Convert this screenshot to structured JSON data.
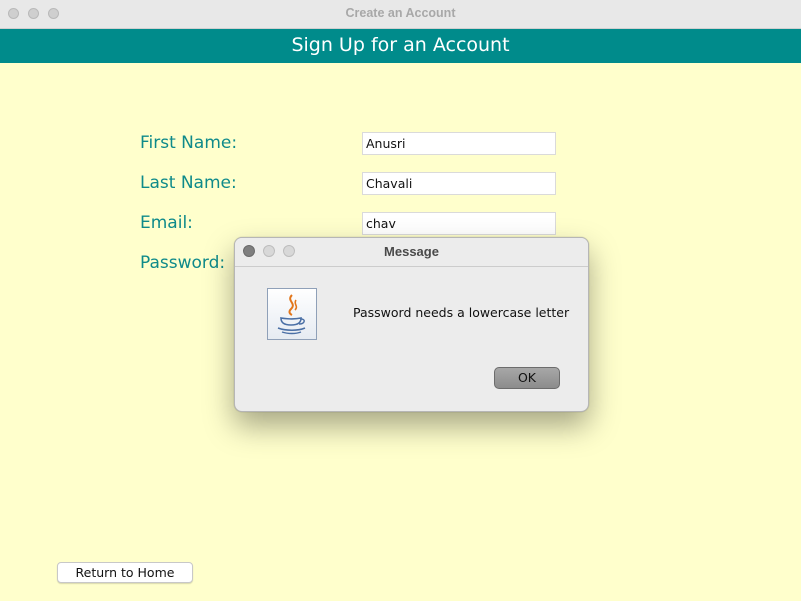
{
  "window": {
    "title": "Create an Account",
    "header": "Sign Up for an Account",
    "background": "#ffffcc",
    "accent": "#008b8b"
  },
  "form": {
    "first_name_label": "First Name:",
    "first_name_value": "Anusri",
    "last_name_label": "Last Name:",
    "last_name_value": "Chavali",
    "email_label": "Email:",
    "email_value": "chav",
    "password_label": "Password:"
  },
  "return_button_label": "Return to Home",
  "dialog": {
    "title": "Message",
    "message": "Password needs a lowercase letter",
    "ok_label": "OK",
    "icon": "java-cup-icon"
  }
}
